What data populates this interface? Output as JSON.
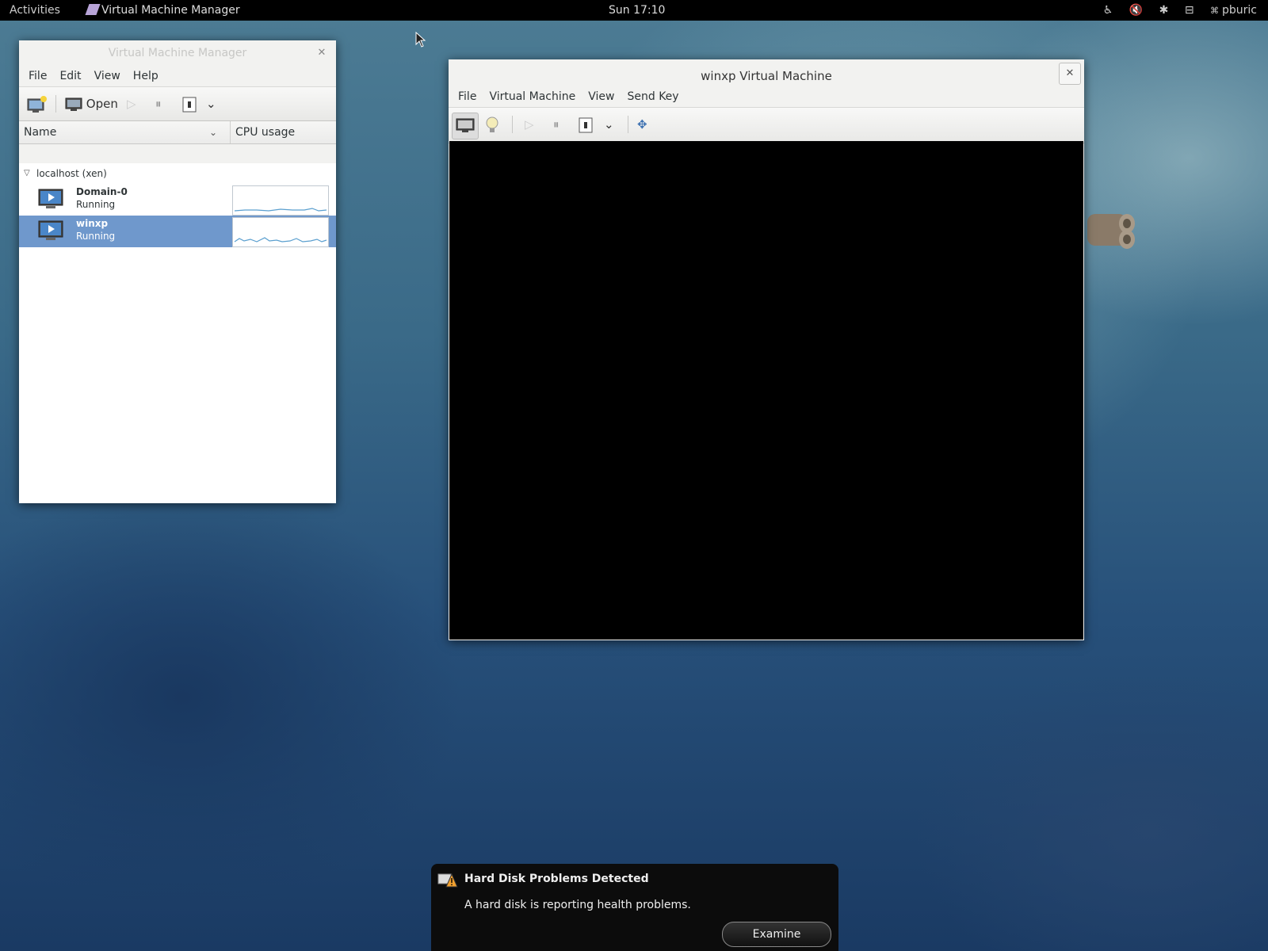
{
  "topbar": {
    "activities": "Activities",
    "app_name": "Virtual Machine Manager",
    "clock": "Sun 17:10",
    "user": "pburic",
    "icons": [
      "accessibility-icon",
      "volume-muted-icon",
      "bluetooth-icon",
      "network-icon"
    ]
  },
  "manager": {
    "title": "Virtual Machine Manager",
    "menu": [
      "File",
      "Edit",
      "View",
      "Help"
    ],
    "toolbar": {
      "open_label": "Open"
    },
    "columns": {
      "name": "Name",
      "cpu": "CPU usage"
    },
    "group": "localhost (xen)",
    "vms": [
      {
        "name": "Domain-0",
        "status": "Running",
        "selected": false
      },
      {
        "name": "winxp",
        "status": "Running",
        "selected": true
      }
    ]
  },
  "vmwindow": {
    "title": "winxp Virtual Machine",
    "menu": [
      "File",
      "Virtual Machine",
      "View",
      "Send Key"
    ]
  },
  "notification": {
    "title": "Hard Disk Problems Detected",
    "body": "A hard disk is reporting health problems.",
    "button": "Examine"
  },
  "colors": {
    "selection": "#6f98cc",
    "panel": "#000000",
    "window_bg": "#f2f2f0"
  }
}
